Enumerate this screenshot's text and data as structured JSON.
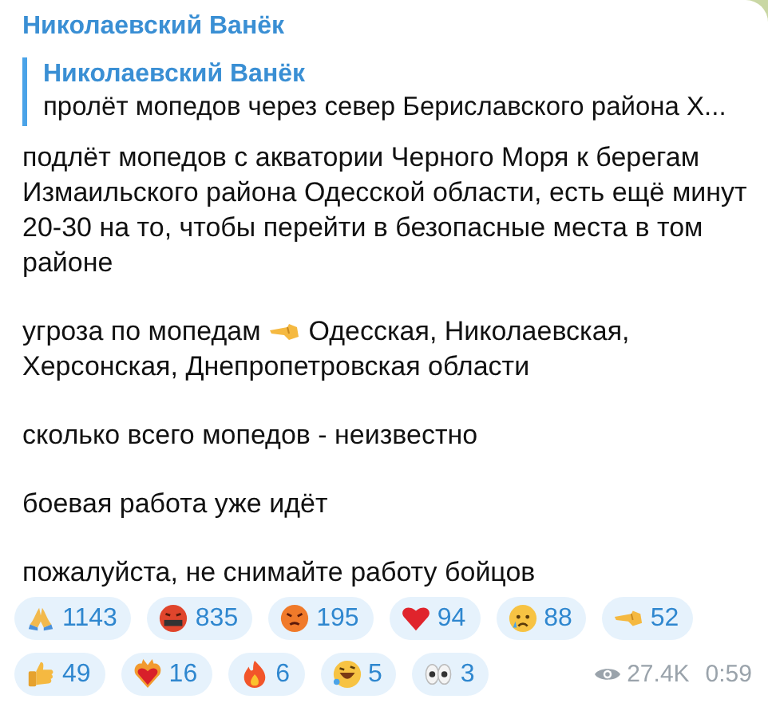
{
  "message": {
    "author": "Николаевский Ванёк",
    "reply": {
      "author": "Николаевский Ванёк",
      "text": "пролёт мопедов через север Бериславского района Х..."
    },
    "paragraphs": [
      {
        "parts": [
          {
            "kind": "text",
            "text": "подлёт мопедов с акватории Черного Моря к берегам Измаильского района Одесской области, есть ещё минут 20-30 на то, чтобы перейти в безопасные места в том районе"
          }
        ]
      },
      {
        "parts": [
          {
            "kind": "text",
            "text": "угроза по мопедам"
          },
          {
            "kind": "pointing_hand"
          },
          {
            "kind": "text",
            "text": "Одесская, Николаевская,"
          },
          {
            "kind": "break"
          },
          {
            "kind": "text",
            "text": "Херсонская, Днепропетровская области"
          }
        ]
      },
      {
        "parts": [
          {
            "kind": "text",
            "text": "сколько всего мопедов - неизвестно"
          }
        ]
      },
      {
        "parts": [
          {
            "kind": "text",
            "text": "боевая работа уже идёт"
          }
        ]
      },
      {
        "parts": [
          {
            "kind": "text",
            "text": "пожалуйста, не снимайте работу бойцов"
          }
        ]
      }
    ],
    "reactions": [
      {
        "kind": "pray",
        "count": "1143"
      },
      {
        "kind": "cursing",
        "count": "835"
      },
      {
        "kind": "angry",
        "count": "195"
      },
      {
        "kind": "heart",
        "count": "94"
      },
      {
        "kind": "crying",
        "count": "88"
      },
      {
        "kind": "pointing_hand",
        "count": "52"
      },
      {
        "kind": "thumbs_up",
        "count": "49"
      },
      {
        "kind": "heart_fire",
        "count": "16"
      },
      {
        "kind": "fire",
        "count": "6"
      },
      {
        "kind": "rofl",
        "count": "5"
      },
      {
        "kind": "eyes",
        "count": "3"
      }
    ],
    "views": "27.4K",
    "time": "0:59"
  }
}
